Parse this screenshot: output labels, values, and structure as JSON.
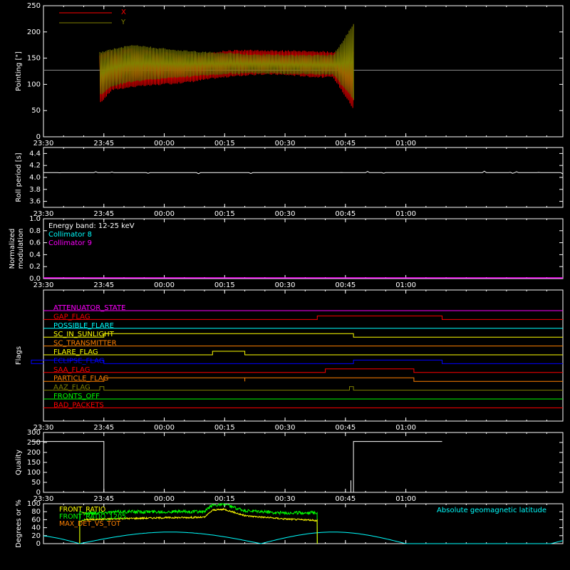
{
  "chart_data": [
    {
      "type": "line",
      "ylabel": "Pointing [\"]",
      "ylim": [
        0,
        250
      ],
      "yticks": [
        0,
        50,
        100,
        150,
        200,
        250
      ],
      "legend": [
        {
          "name": "X",
          "color": "#ff0000"
        },
        {
          "name": "Y",
          "color": "#808000"
        }
      ],
      "legend_placement": "top-left",
      "series": [
        {
          "name": "X",
          "color": "#ff0000",
          "t": [
            "23:44",
            "23:47",
            "23:52",
            "23:57",
            "00:02",
            "00:07",
            "00:12",
            "00:17",
            "00:22",
            "00:27",
            "00:32",
            "00:37",
            "00:42",
            "00:47"
          ],
          "min": [
            62,
            88,
            94,
            97,
            100,
            104,
            110,
            114,
            117,
            118,
            116,
            113,
            112,
            52
          ],
          "max": [
            158,
            165,
            170,
            165,
            160,
            158,
            162,
            166,
            166,
            165,
            165,
            164,
            163,
            162
          ]
        },
        {
          "name": "Y",
          "color": "#808000",
          "t": [
            "23:44",
            "23:47",
            "23:52",
            "23:57",
            "00:02",
            "00:07",
            "00:12",
            "00:17",
            "00:22",
            "00:27",
            "00:32",
            "00:37",
            "00:42",
            "00:47"
          ],
          "min": [
            78,
            95,
            104,
            108,
            111,
            114,
            117,
            119,
            120,
            120,
            119,
            118,
            117,
            70
          ],
          "max": [
            162,
            168,
            176,
            172,
            167,
            164,
            162,
            161,
            158,
            158,
            157,
            157,
            157,
            215
          ]
        }
      ],
      "reference_level": 127
    },
    {
      "type": "line",
      "ylabel": "Roll period [s]",
      "ylim": [
        3.5,
        4.5
      ],
      "yticks": [
        3.6,
        3.8,
        4.0,
        4.2,
        4.4
      ],
      "series": [
        {
          "name": "",
          "color": "#ffffff",
          "value": 4.08
        }
      ]
    },
    {
      "type": "line",
      "ylabel": "Normalized\nmodulation",
      "ylim": [
        0,
        1
      ],
      "yticks": [
        0.0,
        0.2,
        0.4,
        0.6,
        0.8,
        1.0
      ],
      "annotations": [
        {
          "text": "Energy band: 12-25 keV",
          "color": "#ffffff"
        },
        {
          "text": "Collimator 8",
          "color": "#00ffff"
        },
        {
          "text": "Collimator 9",
          "color": "#ff00ff"
        }
      ],
      "series": [
        {
          "name": "Collimator 9",
          "color": "#ff00ff",
          "value": 0.0
        }
      ]
    },
    {
      "type": "line",
      "ylabel": "Flags",
      "flags": [
        {
          "name": "ATTENUATOR_STATE",
          "color": "#ff00ff",
          "on": []
        },
        {
          "name": "GAP_FLAG",
          "color": "#ff0000",
          "on": [
            [
              "00:38",
              "01:09"
            ]
          ]
        },
        {
          "name": "POSSIBLE_FLARE",
          "color": "#00ffff",
          "on": []
        },
        {
          "name": "SC_IN_SUNLIGHT",
          "color": "#ffff00",
          "on": [
            [
              "23:45",
              "00:47"
            ]
          ]
        },
        {
          "name": "SC_TRANSMITTER",
          "color": "#ff8000",
          "on": []
        },
        {
          "name": "FLARE_FLAG",
          "color": "#ffff00",
          "on": [
            [
              "00:12",
              "00:20"
            ]
          ]
        },
        {
          "name": "ECLIPSE_FLAG",
          "color": "#0000ff",
          "on": [
            [
              "23:27",
              "23:45"
            ],
            [
              "00:47",
              "01:09"
            ]
          ]
        },
        {
          "name": "SAA_FLAG",
          "color": "#ff0000",
          "on": [
            [
              "00:40",
              "01:02"
            ]
          ]
        },
        {
          "name": "PARTICLE_FLAG",
          "color": "#ff8000",
          "on": [
            [
              "23:45",
              "00:20"
            ],
            [
              "00:20",
              "01:02"
            ]
          ]
        },
        {
          "name": "AAZ_FLAG",
          "color": "#808000",
          "on": [
            [
              "23:44",
              "23:45"
            ],
            [
              "00:46",
              "00:47"
            ]
          ]
        },
        {
          "name": "FRONTS_OFF",
          "color": "#00ff00",
          "on": []
        },
        {
          "name": "BAD_PACKETS",
          "color": "#ff0000",
          "on": []
        }
      ]
    },
    {
      "type": "line",
      "ylabel": "Quality",
      "ylim": [
        0,
        300
      ],
      "yticks": [
        0,
        50,
        100,
        150,
        200,
        250,
        300
      ],
      "series": [
        {
          "name": "",
          "color": "#ffffff",
          "t": [
            "23:27",
            "23:45",
            "23:45",
            "00:47",
            "00:47",
            "01:09"
          ],
          "y": [
            255,
            255,
            0,
            0,
            255,
            255
          ]
        }
      ]
    },
    {
      "type": "line",
      "ylabel": "Degrees or %",
      "ylim": [
        0,
        100
      ],
      "yticks": [
        0,
        20,
        40,
        60,
        80,
        100
      ],
      "annotations": [
        {
          "text": "Absolute geomagnetic latitude",
          "color": "#00ffff"
        }
      ],
      "legend": [
        {
          "name": "FRONT_RATIO",
          "color": "#ffff00"
        },
        {
          "name": "FRONT_RATIO_1205",
          "color": "#00ff00"
        },
        {
          "name": "MAX_DET_VS_TOT",
          "color": "#ff8000"
        }
      ],
      "series": [
        {
          "name": "FRONT_RATIO",
          "color": "#ffff00",
          "t": [
            "23:39",
            "23:40",
            "23:50",
            "00:00",
            "00:10",
            "00:12",
            "00:15",
            "00:20",
            "00:30",
            "00:38"
          ],
          "y": [
            55,
            60,
            63,
            65,
            66,
            84,
            86,
            70,
            62,
            58
          ]
        },
        {
          "name": "FRONT_RATIO_1205",
          "color": "#00ff00",
          "t": [
            "23:39",
            "23:40",
            "23:50",
            "00:00",
            "00:10",
            "00:12",
            "00:15",
            "00:20",
            "00:30",
            "00:38"
          ],
          "y": [
            80,
            76,
            80,
            80,
            80,
            97,
            98,
            82,
            77,
            78
          ]
        },
        {
          "name": "Absolute geomagnetic latitude",
          "color": "#00ffff",
          "t": [
            "23:27",
            "23:39",
            "23:57",
            "00:24",
            "00:42",
            "01:09"
          ],
          "y": [
            21,
            0,
            29,
            0,
            29,
            3
          ]
        }
      ]
    }
  ],
  "x_axis": {
    "ticks": [
      "23:30",
      "23:45",
      "00:00",
      "00:15",
      "00:30",
      "00:45",
      "01:00"
    ]
  }
}
